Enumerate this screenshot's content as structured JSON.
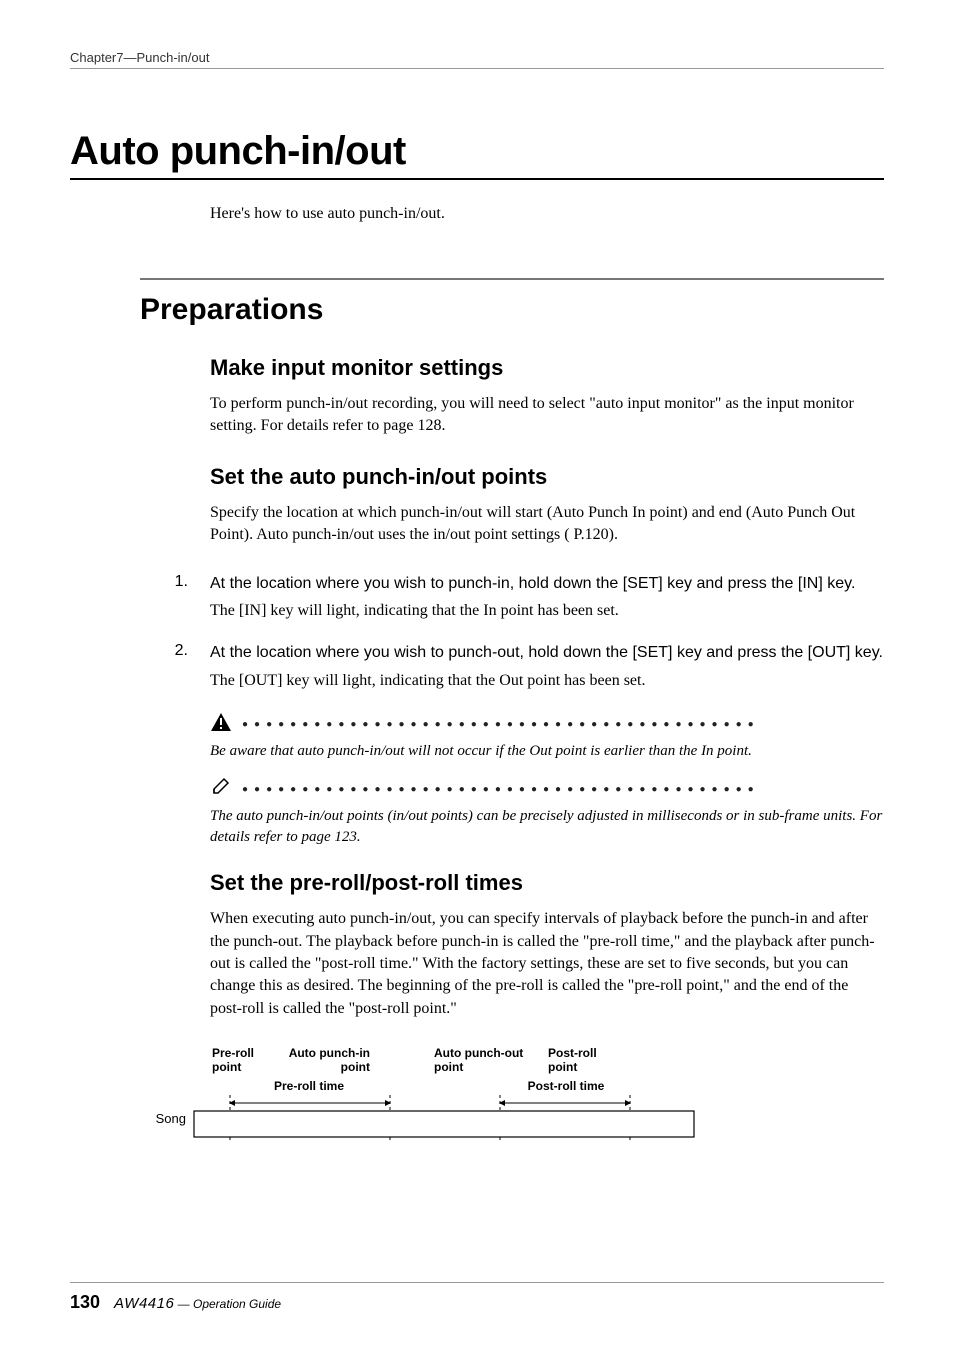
{
  "header": {
    "chapter_line": "Chapter7—Punch-in/out"
  },
  "h1": "Auto punch-in/out",
  "intro": "Here's how to use auto punch-in/out.",
  "h2": "Preparations",
  "section1": {
    "title": "Make input monitor settings",
    "body": "To perform punch-in/out recording, you will need to select \"auto input monitor\" as the input monitor setting. For details refer to page 128."
  },
  "section2": {
    "title": "Set the auto punch-in/out points",
    "body": "Specify the location at which punch-in/out will start (Auto Punch In point) and end (Auto Punch Out Point). Auto punch-in/out uses the in/out point settings ( P.120).",
    "step1": {
      "num": "1.",
      "title": "At the location where you wish to punch-in, hold down the [SET] key and press the [IN] key.",
      "body": "The [IN] key will light, indicating that the In point has been set."
    },
    "step2": {
      "num": "2.",
      "title": "At the location where you wish to punch-out, hold down the [SET] key and press the [OUT] key.",
      "body": "The [OUT] key will light, indicating that the Out point has been set."
    },
    "warning": "Be aware that auto punch-in/out will not occur if the Out point is earlier than the In point.",
    "tip": "The auto punch-in/out points (in/out points) can be precisely adjusted in milliseconds or in sub-frame units. For details refer to page 123."
  },
  "section3": {
    "title": "Set the pre-roll/post-roll times",
    "body": "When executing auto punch-in/out, you can specify intervals of playback before the punch-in and after the punch-out. The playback before punch-in is called the \"pre-roll time,\" and the playback after punch-out is called the \"post-roll time.\" With the factory settings, these are set to five seconds, but you can change this as desired. The beginning of the pre-roll is called the \"pre-roll point,\" and the end of the post-roll is called the \"post-roll point.\""
  },
  "chart_data": {
    "type": "diagram",
    "labels": {
      "preroll_point": "Pre-roll point",
      "punch_in_point": "Auto punch-in point",
      "punch_out_point": "Auto punch-out point",
      "postroll_point": "Post-roll point",
      "preroll_time": "Pre-roll time",
      "postroll_time": "Post-roll time",
      "song": "Song"
    }
  },
  "footer": {
    "page": "130",
    "model": "AW4416",
    "guide": " — Operation Guide"
  },
  "dots": "●●●●●●●●●●●●●●●●●●●●●●●●●●●●●●●●●●●●●●●●●●●"
}
